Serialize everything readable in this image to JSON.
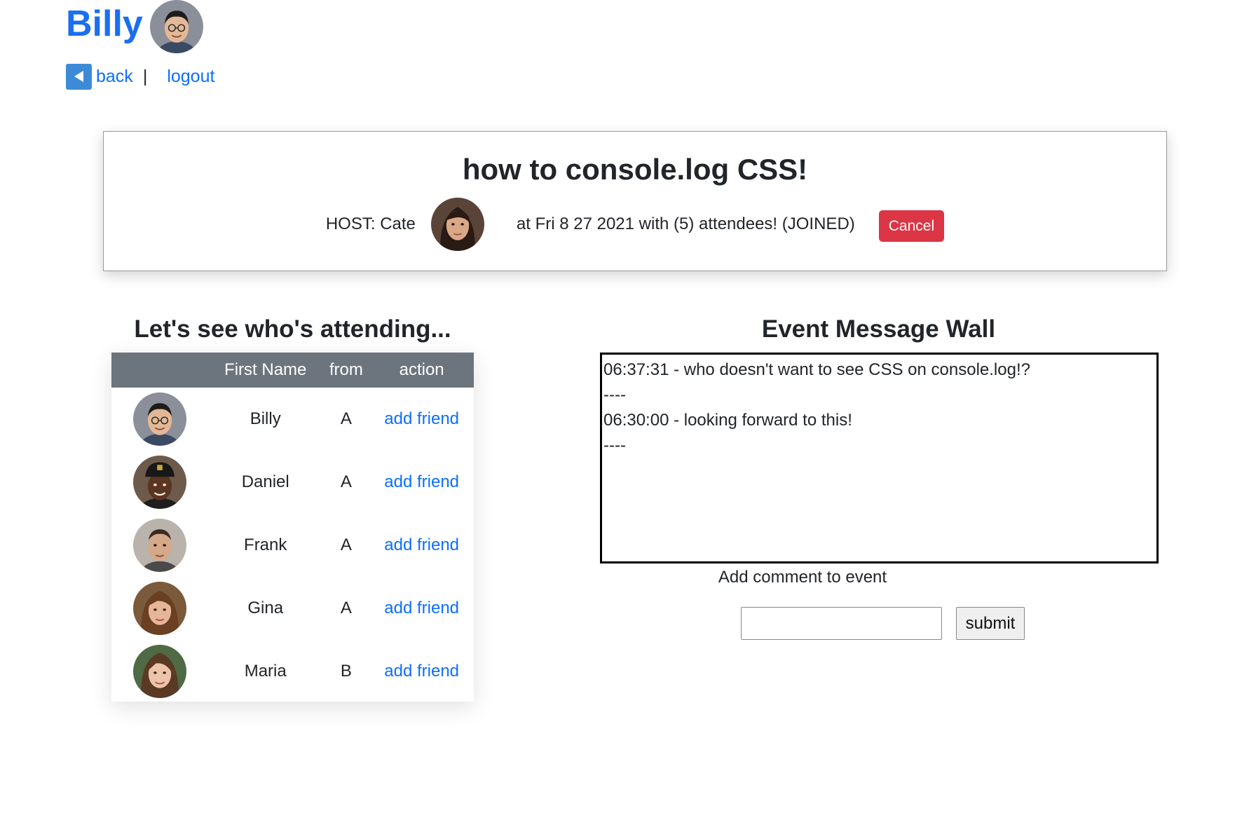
{
  "user": {
    "name": "Billy",
    "back_label": "back",
    "separator": "|",
    "logout_label": "logout"
  },
  "event": {
    "title": "how to console.log CSS!",
    "host_label": "HOST: Cate",
    "details": "at Fri 8 27 2021 with (5) attendees! (JOINED)",
    "cancel_label": "Cancel"
  },
  "attendees": {
    "heading": "Let's see who's attending...",
    "columns": [
      "",
      "First Name",
      "from",
      "action"
    ],
    "rows": [
      {
        "first_name": "Billy",
        "from": "A",
        "action": "add friend"
      },
      {
        "first_name": "Daniel",
        "from": "A",
        "action": "add friend"
      },
      {
        "first_name": "Frank",
        "from": "A",
        "action": "add friend"
      },
      {
        "first_name": "Gina",
        "from": "A",
        "action": "add friend"
      },
      {
        "first_name": "Maria",
        "from": "B",
        "action": "add friend"
      }
    ]
  },
  "wall": {
    "heading": "Event Message Wall",
    "lines": [
      "06:37:31 - who doesn't want to see CSS on console.log!?",
      "----",
      "06:30:00 - looking forward to this!",
      "----"
    ],
    "comment_label": "Add comment to event",
    "comment_value": "",
    "submit_label": "submit"
  },
  "colors": {
    "link": "#0d6efd",
    "username": "#1a6ff0",
    "cancel": "#dc3545",
    "table_header": "#6c757d",
    "back_icon": "#3d8bd6"
  }
}
